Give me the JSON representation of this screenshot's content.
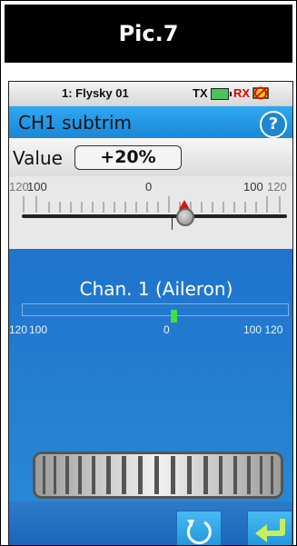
{
  "header": {
    "title": "Pic.7"
  },
  "status": {
    "model": "1: Flysky 01",
    "tx_label": "TX",
    "rx_label": "RX",
    "tx_battery_level": 1.0
  },
  "titlebar": {
    "title": "CH1 subtrim",
    "help_icon": "question-mark-icon",
    "help_label": "?"
  },
  "value": {
    "label": "Value",
    "display": "+20%"
  },
  "slider": {
    "left_far": "120",
    "left_near": "100",
    "center": "0",
    "right_near": "100",
    "right_far": "120",
    "value_fraction": 0.55
  },
  "channel": {
    "label": "Chan. 1 (Aileron)",
    "scale_left_far": "120",
    "scale_left_near": "100",
    "scale_center": "0",
    "scale_right": "100 120"
  },
  "colors": {
    "accent_blue": "#1f87d1",
    "indicator_green": "#43e13d",
    "alert_red": "#dd1111"
  },
  "buttons": {
    "undo_icon": "undo-icon",
    "ok_icon": "return-arrow-icon"
  }
}
